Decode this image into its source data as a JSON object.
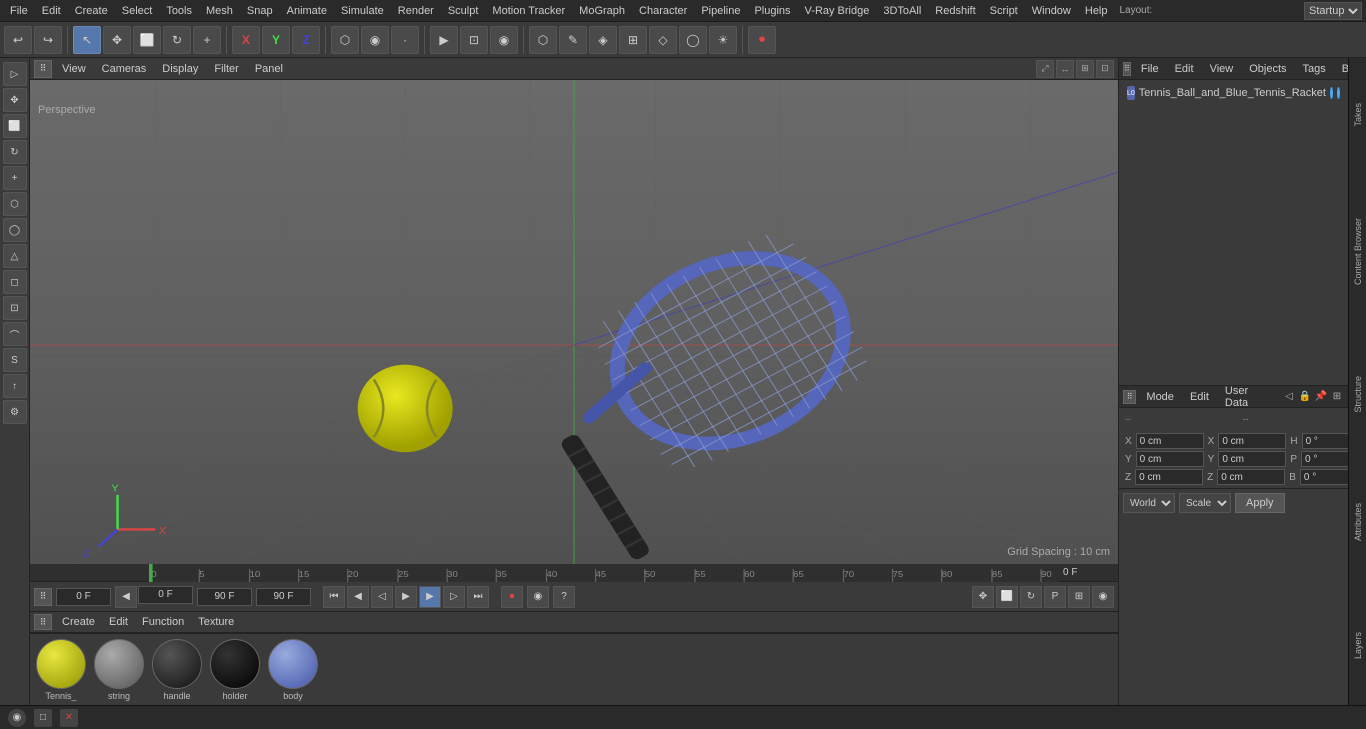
{
  "menubar": {
    "items": [
      "File",
      "Edit",
      "Create",
      "Select",
      "Tools",
      "Mesh",
      "Snap",
      "Animate",
      "Simulate",
      "Render",
      "Sculpt",
      "Motion Tracker",
      "MoGraph",
      "Character",
      "Pipeline",
      "Plugins",
      "V-Ray Bridge",
      "3DToAll",
      "Redshift",
      "Script",
      "Window",
      "Help"
    ],
    "layout_label": "Layout:",
    "layout_value": "Startup"
  },
  "toolbar": {
    "undo_icon": "↩",
    "redo_icon": "↪",
    "move_icon": "✥",
    "scale_icon": "⤢",
    "rotate_icon": "↻",
    "x_icon": "X",
    "y_icon": "Y",
    "z_icon": "Z",
    "add_icon": "+",
    "render_icons": [
      "▶",
      "◉",
      "⊡"
    ],
    "mode_icons": [
      "⬡",
      "✎",
      "◈",
      "⊞",
      "⊡",
      "◯",
      "⊞"
    ],
    "record_icon": "⏺"
  },
  "viewport": {
    "menu_items": [
      "View",
      "Cameras",
      "Display",
      "Filter",
      "Panel"
    ],
    "perspective_label": "Perspective",
    "grid_spacing": "Grid Spacing : 10 cm",
    "timeline_numbers": [
      0,
      5,
      10,
      15,
      20,
      25,
      30,
      35,
      40,
      45,
      50,
      55,
      60,
      65,
      70,
      75,
      80,
      85,
      90
    ]
  },
  "left_sidebar": {
    "icons": [
      "▷",
      "✥",
      "⬜",
      "↻",
      "+",
      "⬡",
      "◯",
      "△",
      "◻",
      "⊡",
      "⌒",
      "S",
      "↑",
      "⚙"
    ]
  },
  "timeline": {
    "current_frame_label": "0 F",
    "start_frame": "0 F",
    "end_frame": "90 F",
    "end_frame2": "90 F",
    "numbers": [
      0,
      5,
      10,
      15,
      20,
      25,
      30,
      35,
      40,
      45,
      50,
      55,
      60,
      65,
      70,
      75,
      80,
      85,
      90
    ],
    "current_frame_right": "0 F"
  },
  "playback": {
    "buttons": [
      "⏮",
      "⏭",
      "⏴",
      "⏩",
      "▶",
      "⏭",
      "⏮",
      "⏭"
    ]
  },
  "materials": {
    "menu_items": [
      "Create",
      "Edit",
      "Function",
      "Texture"
    ],
    "items": [
      {
        "label": "Tennis_",
        "color": "#c8c810",
        "type": "sphere"
      },
      {
        "label": "string",
        "color": "#888888",
        "type": "sphere"
      },
      {
        "label": "handle",
        "color": "#222222",
        "type": "sphere"
      },
      {
        "label": "holder",
        "color": "#111111",
        "type": "sphere"
      },
      {
        "label": "body",
        "color": "#6688bb",
        "type": "sphere"
      }
    ]
  },
  "object_manager": {
    "menu_items": [
      "File",
      "Edit",
      "View",
      "Objects",
      "Tags",
      "Bookmarks"
    ],
    "search_icon": "🔍",
    "object": {
      "name": "Tennis_Ball_and_Blue_Tennis_Racket",
      "icon": "L0",
      "dot1_color": "#44aaff",
      "dot2_color": "#44aaff"
    }
  },
  "attributes": {
    "menu_items": [
      "Mode",
      "Edit",
      "User Data"
    ],
    "coords": {
      "x_pos": "0 cm",
      "y_pos": "0 cm",
      "z_pos": "0 cm",
      "x_rot": "0 cm",
      "y_rot": "0 cm",
      "z_rot": "0 cm",
      "h_val": "0 °",
      "p_val": "0 °",
      "b_val": "0 °"
    },
    "coord_labels": {
      "x": "X",
      "y": "Y",
      "z": "Z",
      "h": "H",
      "p": "P",
      "b": "B"
    },
    "world_label": "World",
    "scale_label": "Scale",
    "apply_label": "Apply"
  },
  "right_tabs": [
    "Takes",
    "Content Browser",
    "Structure",
    "Attributes",
    "Layers"
  ],
  "bottom": {
    "icon1": "◉",
    "icon2": "□",
    "icon3": "✕"
  },
  "colors": {
    "accent": "#5577aa",
    "bg_dark": "#2a2a2a",
    "bg_mid": "#3a3a3a",
    "bg_light": "#4a4a4a",
    "border": "#555555",
    "text": "#cccccc",
    "grid": "#686868"
  }
}
